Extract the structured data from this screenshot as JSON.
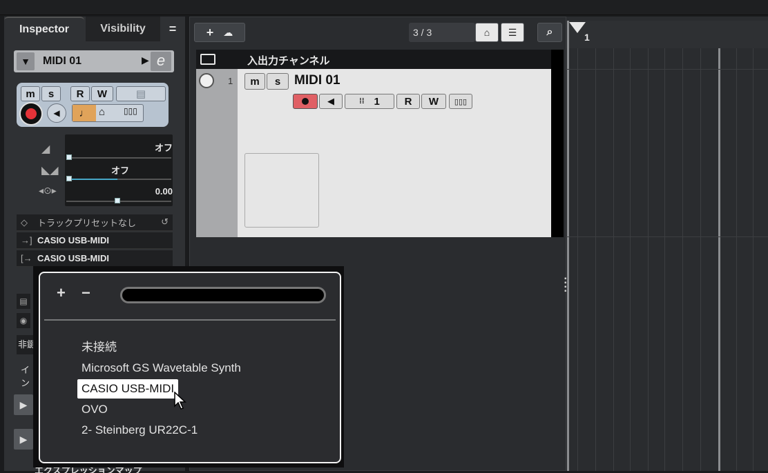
{
  "inspector": {
    "tabs": [
      "Inspector",
      "Visibility"
    ],
    "menu_glyph": "=",
    "track_name": "MIDI 01",
    "ms": {
      "m": "m",
      "s": "s"
    },
    "rw": {
      "r": "R",
      "w": "W"
    },
    "volume_value": "オフ",
    "pan_value": "オフ",
    "delay_value": "0.00",
    "preset_label": "トラックプリセットなし",
    "input_routing": "CASIO USB-MIDI",
    "output_routing": "CASIO USB-MIDI",
    "lower_labels": [
      "非鍵",
      "イン"
    ],
    "bottom_label": "エクスプレッションマップ"
  },
  "toolbar": {
    "add_label": "+",
    "counter": "3 / 3"
  },
  "tracklist": {
    "folder_name": "入出力チャンネル",
    "track_number": "1",
    "track_name": "MIDI 01",
    "m": "m",
    "s": "s",
    "channel": "1",
    "r": "R",
    "w": "W"
  },
  "ruler": {
    "bar_number": "1"
  },
  "popup": {
    "plus": "+",
    "minus": "−",
    "options": [
      "未接続",
      "Microsoft GS Wavetable Synth",
      "CASIO USB-MIDI",
      "OVO",
      "2- Steinberg UR22C-1"
    ],
    "selected_index": 2
  }
}
